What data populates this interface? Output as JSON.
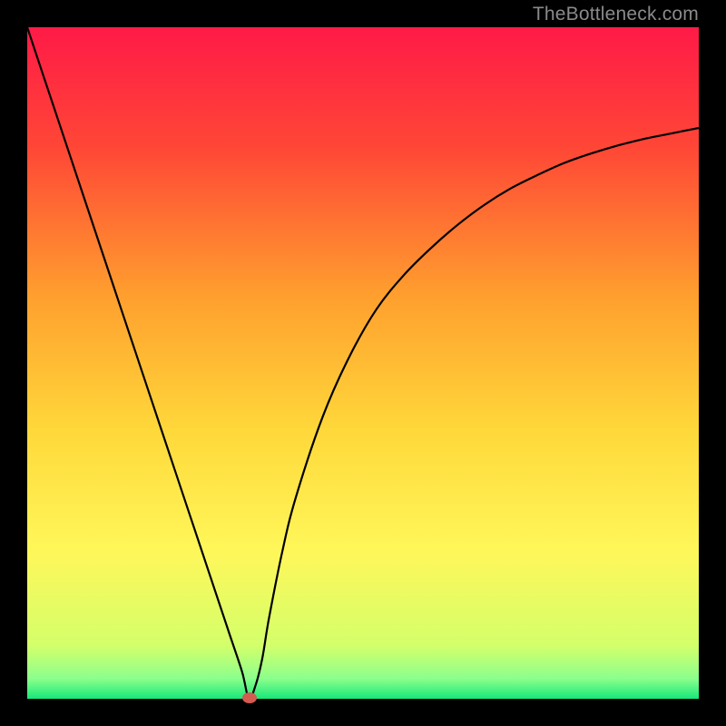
{
  "watermark": "TheBottleneck.com",
  "colors": {
    "frame": "#000000",
    "curve": "#000000",
    "optimum_dot": "#d35b50",
    "gradient_stops": [
      {
        "pct": 0,
        "color": "#ff1a47"
      },
      {
        "pct": 18,
        "color": "#ff4736"
      },
      {
        "pct": 40,
        "color": "#ff9f2e"
      },
      {
        "pct": 60,
        "color": "#ffd83a"
      },
      {
        "pct": 78,
        "color": "#fff75a"
      },
      {
        "pct": 92,
        "color": "#d4ff6a"
      },
      {
        "pct": 97,
        "color": "#8cff8c"
      },
      {
        "pct": 100,
        "color": "#17e87a"
      }
    ]
  },
  "axes": {
    "x_range": [
      0,
      100
    ],
    "y_range": [
      0,
      100
    ],
    "show_grid": false,
    "show_ticks": false
  },
  "chart_data": {
    "type": "line",
    "title": "",
    "xlabel": "",
    "ylabel": "",
    "xlim": [
      0,
      100
    ],
    "ylim": [
      0,
      100
    ],
    "annotations": [
      "TheBottleneck.com"
    ],
    "optimum_x": 33,
    "series": [
      {
        "name": "bottleneck-curve",
        "x": [
          0,
          4,
          8,
          12,
          16,
          20,
          24,
          28,
          30,
          32,
          33,
          34,
          35,
          36,
          38,
          40,
          44,
          48,
          52,
          56,
          60,
          64,
          68,
          72,
          76,
          80,
          84,
          88,
          92,
          96,
          100
        ],
        "values": [
          100,
          88,
          76,
          64,
          52,
          40,
          28,
          16,
          10,
          4,
          0,
          2,
          6,
          12,
          22,
          30,
          42,
          51,
          58,
          63,
          67,
          70.5,
          73.5,
          76,
          78,
          79.8,
          81.2,
          82.4,
          83.4,
          84.2,
          85
        ]
      }
    ]
  }
}
